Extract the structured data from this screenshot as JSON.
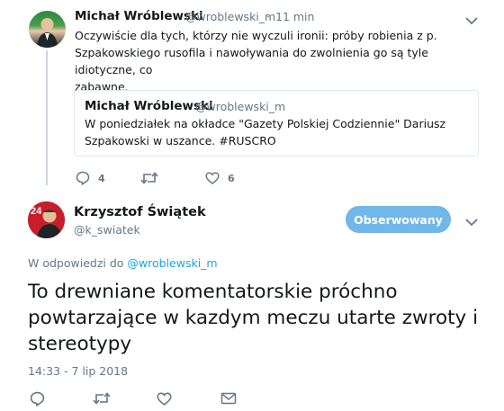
{
  "parent_tweet": {
    "author_name": "Michał Wróblewski",
    "author_handle": "@wroblewski_m",
    "separator": "·",
    "time": "11 min",
    "text_lines": [
      "Oczywiście dla tych, którzy nie wyczuli ironii: próby robienia z p.",
      "Szpakowskiego rusofila i nawoływania do zwolnienia go są tyle idiotyczne, co",
      "zabawne."
    ],
    "quoted": {
      "author_name": "Michał Wróblewski",
      "author_handle": "@wroblewski_m",
      "text_lines": [
        "W poniedziałek na okładce \"Gazety Polskiej Codziennie\" Dariusz",
        "Szpakowski w uszance. #RUSCRO"
      ]
    },
    "actions": {
      "reply_count": "4",
      "retweet_count": "",
      "like_count": "6"
    }
  },
  "main_tweet": {
    "author_name": "Krzysztof Świątek",
    "author_handle": "@k_swiatek",
    "follow_label": "Obserwowany",
    "reply_prefix": "W odpowiedzi do",
    "reply_to": "@wroblewski_m",
    "text": "To drewniane komentatorskie próchno powtarzające w kazdym meczu utarte zwroty i stereotypy",
    "timestamp": "14:33 - 7 lip 2018"
  },
  "colors": {
    "accent": "#1da1f2",
    "follow_button_bg": "#71b7e9",
    "thread_line": "#ccd6dd",
    "muted": "#657786"
  }
}
